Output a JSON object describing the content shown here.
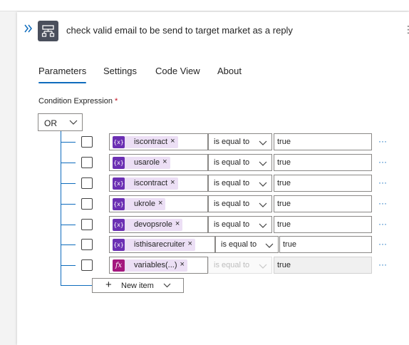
{
  "header": {
    "title": "check valid email to be send to target market as a reply",
    "collapse_icon": "double-chevron-right-icon",
    "action_icon": "condition-icon",
    "more_icon": "ellipsis-icon"
  },
  "tabs": [
    {
      "label": "Parameters",
      "active": true
    },
    {
      "label": "Settings",
      "active": false
    },
    {
      "label": "Code View",
      "active": false
    },
    {
      "label": "About",
      "active": false
    }
  ],
  "condition": {
    "label": "Condition Expression",
    "required_mark": "*",
    "group_operator": "OR",
    "rows": [
      {
        "token_icon": "{x}",
        "token": "iscontract",
        "token_remove": "×",
        "operator": "is equal to",
        "value": "true",
        "disabled": false
      },
      {
        "token_icon": "{x}",
        "token": "usarole",
        "token_remove": "×",
        "operator": "is equal to",
        "value": "true",
        "disabled": false
      },
      {
        "token_icon": "{x}",
        "token": "iscontract",
        "token_remove": "×",
        "operator": "is equal to",
        "value": "true",
        "disabled": false
      },
      {
        "token_icon": "{x}",
        "token": "ukrole",
        "token_remove": "×",
        "operator": "is equal to",
        "value": "true",
        "disabled": false
      },
      {
        "token_icon": "{x}",
        "token": "devopsrole",
        "token_remove": "×",
        "operator": "is equal to",
        "value": "true",
        "disabled": false
      },
      {
        "token_icon": "{x}",
        "token": "isthisarecruiter",
        "token_remove": "×",
        "operator": "is equal to",
        "value": "true",
        "disabled": false
      },
      {
        "token_icon": "fx",
        "token": "variables(...)",
        "token_remove": "×",
        "operator": "is equal to",
        "value": "true",
        "disabled": true
      }
    ],
    "row_more": "···",
    "new_item": {
      "plus": "+",
      "label": "New item"
    }
  },
  "colors": {
    "accent": "#0f6cbd",
    "variable_token": "#6b2fb3",
    "expression_token": "#a4177e",
    "token_background": "#ecdff5"
  }
}
